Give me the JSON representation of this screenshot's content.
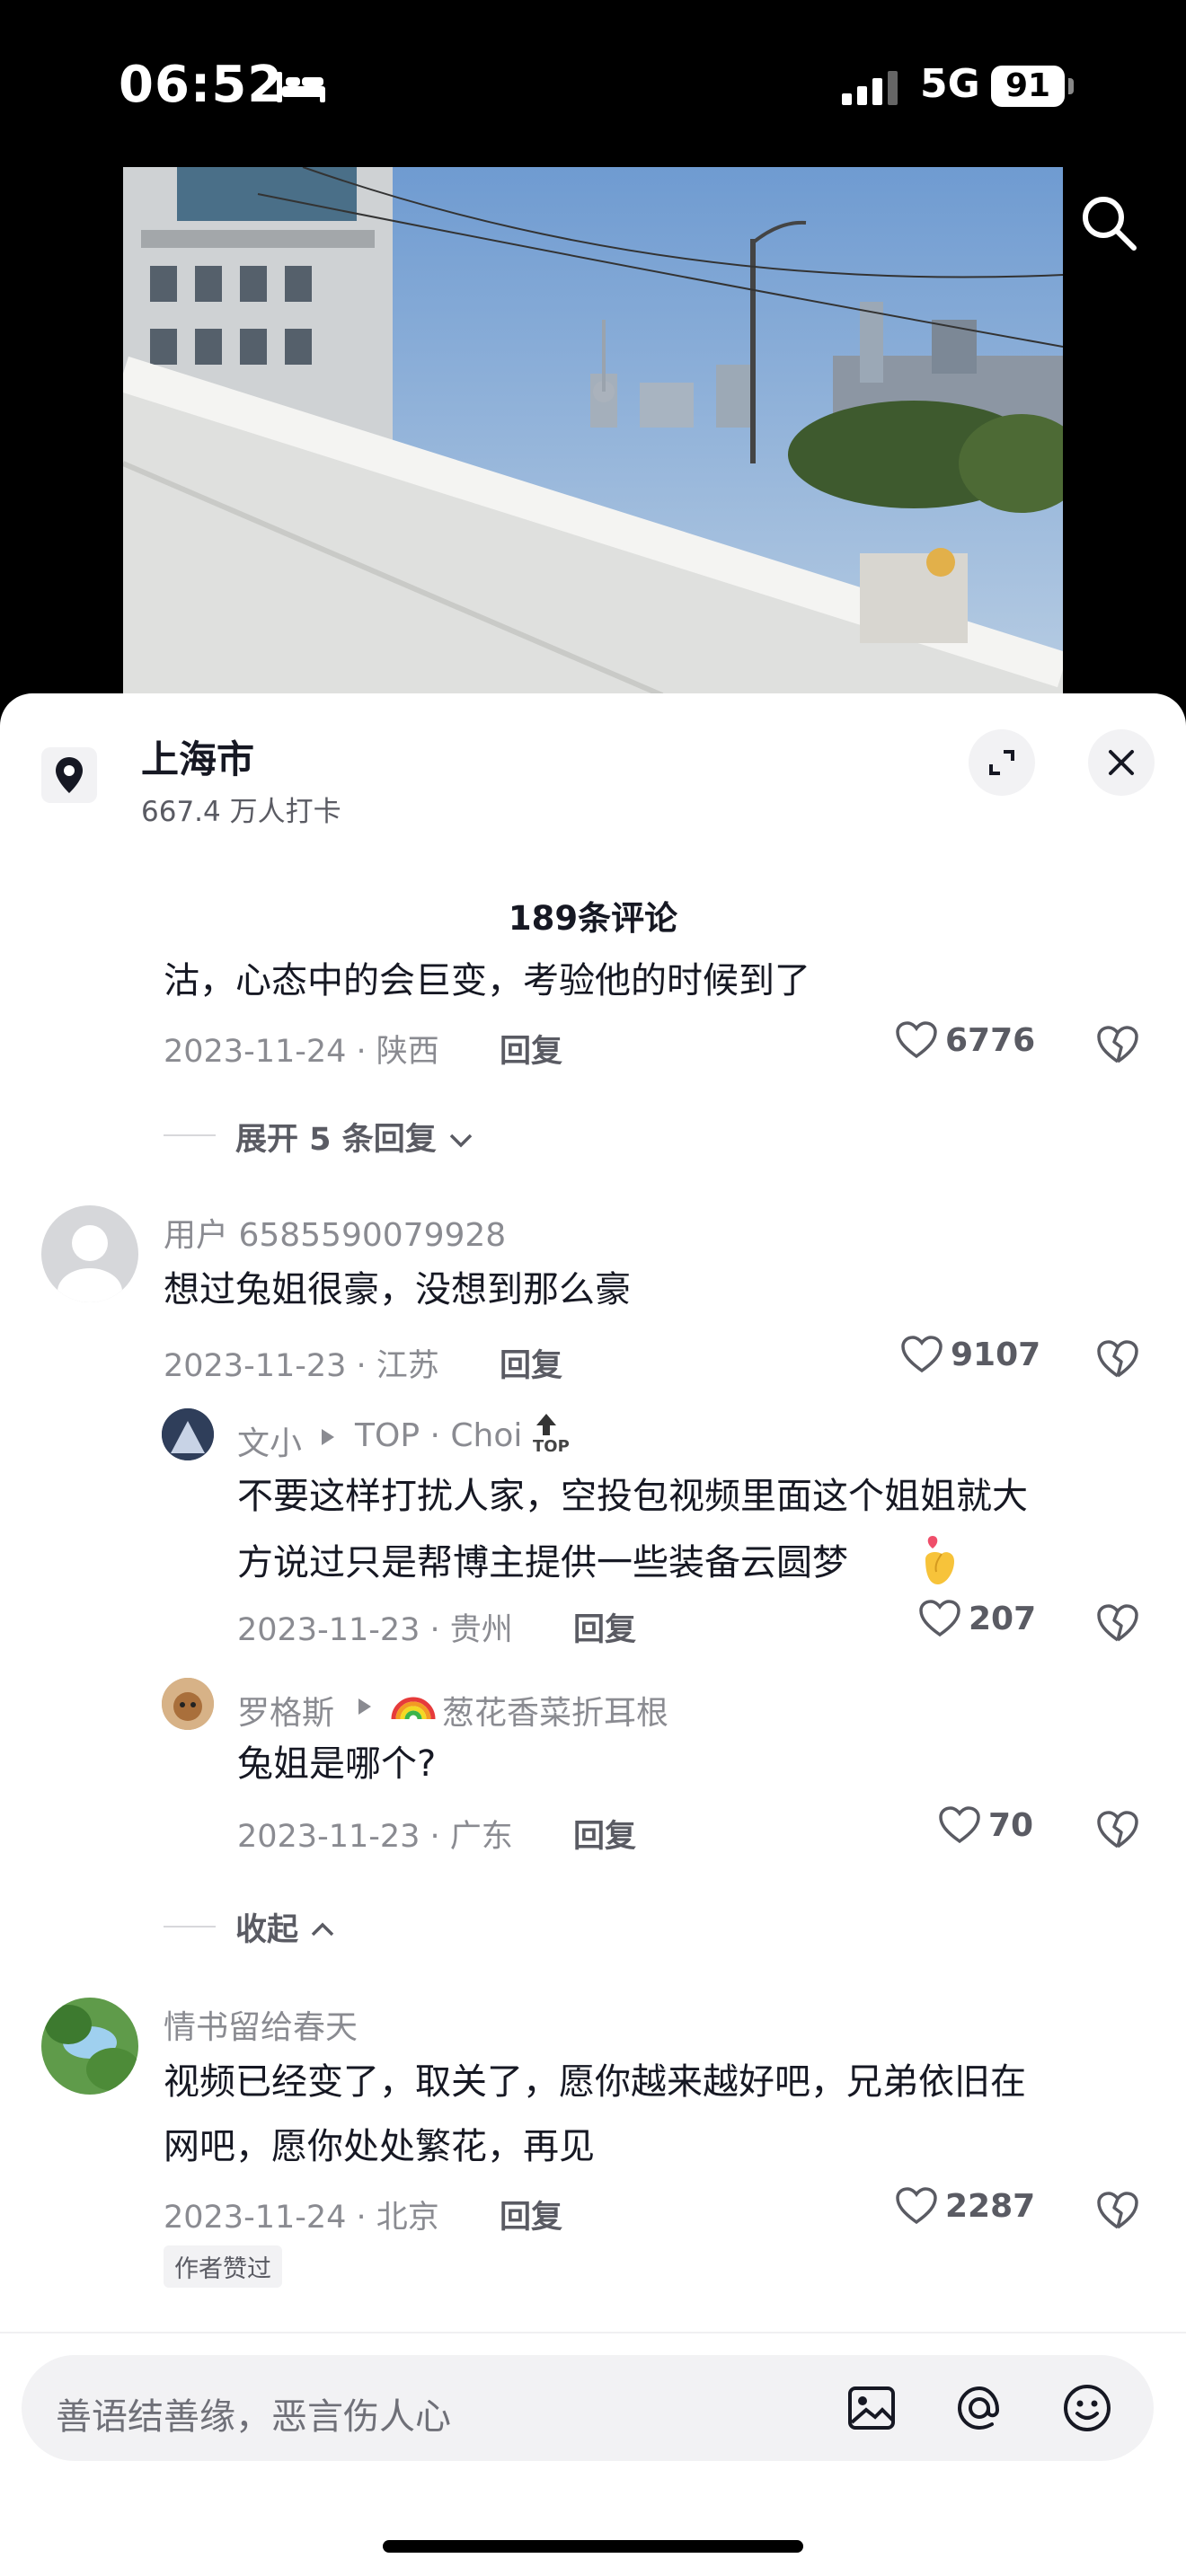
{
  "status": {
    "time": "06:52",
    "network": "5G",
    "battery": "91"
  },
  "icons": {
    "bed": "bed-icon",
    "signal": "signal-icon",
    "search": "search-icon",
    "location": "location-pin-icon",
    "expand": "expand-icon",
    "close": "close-icon",
    "like": "heart-icon",
    "dislike": "broken-heart-icon",
    "chevron": "chevron-icon",
    "image": "image-icon",
    "mention": "at-icon",
    "emoji": "emoji-icon"
  },
  "location": {
    "title": "上海市",
    "subtitle": "667.4 万人打卡"
  },
  "comments_header": {
    "count_label": "189条评论"
  },
  "comments": [
    {
      "text": "沽，心态中的会巨变，考验他的时候到了",
      "date_region": "2023-11-24 · 陕西",
      "reply_label": "回复",
      "likes": "6776",
      "expand_label": "展开 5 条回复"
    },
    {
      "username": "用户 6585590079928",
      "text": "想过兔姐很豪，没想到那么豪",
      "date_region": "2023-11-23 · 江苏",
      "reply_label": "回复",
      "likes": "9107",
      "replies": [
        {
          "username": "文小",
          "reply_to": "TOP · Choi",
          "badge": "TOP",
          "text_line1": "不要这样打扰人家，空投包视频里面这个姐姐就大",
          "text_line2": "方说过只是帮博主提供一些装备云圆梦",
          "date_region": "2023-11-23 · 贵州",
          "reply_label": "回复",
          "likes": "207"
        },
        {
          "username": "罗格斯",
          "reply_to": "葱花香菜折耳根",
          "text": "兔姐是哪个?",
          "date_region": "2023-11-23 · 广东",
          "reply_label": "回复",
          "likes": "70"
        }
      ],
      "collapse_label": "收起"
    },
    {
      "username": "情书留给春天",
      "text_line1": "视频已经变了，取关了，愿你越来越好吧，兄弟依旧在",
      "text_line2": "网吧，愿你处处繁花，再见",
      "date_region": "2023-11-24 · 北京",
      "reply_label": "回复",
      "likes": "2287",
      "badge": "作者赞过"
    }
  ],
  "input": {
    "placeholder": "善语结善缘，恶言伤人心"
  },
  "colors": {
    "sky": "#8fb3dc",
    "sheet": "#ffffff",
    "muted": "#8a8b91"
  }
}
